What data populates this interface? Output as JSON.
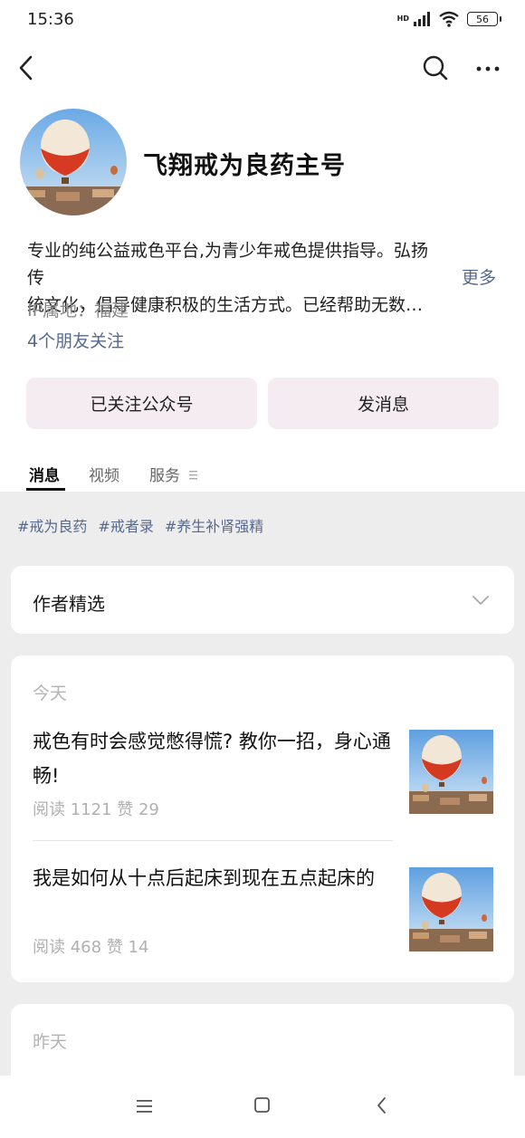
{
  "status_bar": {
    "time": "15:36",
    "network": "HD",
    "battery": "56"
  },
  "nav": {
    "back_icon": "chevron-left-icon",
    "search_icon": "search-icon",
    "more_icon": "more-dots-icon"
  },
  "profile": {
    "name": "飞翔戒为良药主号",
    "bio_line1": "专业的纯公益戒色平台,为青少年戒色提供指导。弘扬传",
    "bio_line2": "统文化，倡导健康积极的生活方式。已经帮助无数…",
    "more_label": "更多",
    "ip": "IP属地：福建",
    "friends": "4个朋友关注"
  },
  "buttons": {
    "followed": "已关注公众号",
    "message": "发消息"
  },
  "tabs": [
    {
      "label": "消息",
      "active": true
    },
    {
      "label": "视频",
      "active": false
    },
    {
      "label": "服务",
      "active": false
    }
  ],
  "tags": [
    "#戒为良药",
    "#戒者录",
    "#养生补肾强精"
  ],
  "author_pick": {
    "label": "作者精选"
  },
  "sections": [
    {
      "day": "今天",
      "articles": [
        {
          "title": "戒色有时会感觉憋得慌? 教你一招，身心通畅!",
          "meta": "阅读 1121   赞 29"
        },
        {
          "title": "我是如何从十点后起床到现在五点起床的",
          "meta": "阅读 468   赞 14"
        }
      ]
    },
    {
      "day": "昨天"
    }
  ],
  "colors": {
    "link": "#56698f",
    "button_bg": "#f4ecf0",
    "page_gray": "#ededed"
  }
}
